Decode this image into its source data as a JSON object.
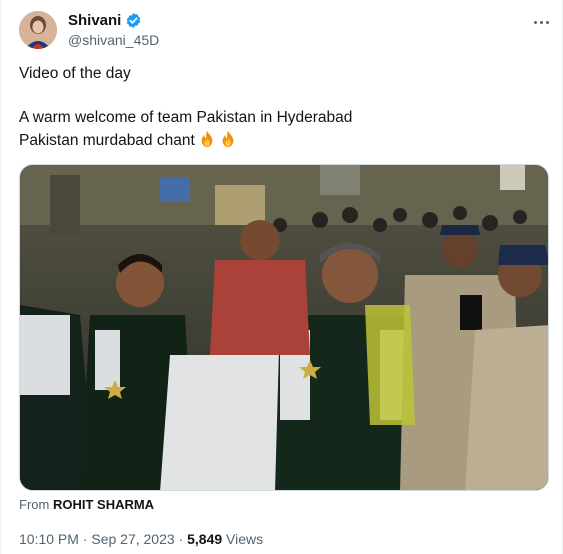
{
  "tweet": {
    "display_name": "Shivani",
    "handle": "@shivani_45D",
    "more_icon": "ellipsis-icon",
    "line1": "Video of the day",
    "line2": "A warm welcome of team Pakistan in Hyderabad",
    "line3": "Pakistan murdabad chant",
    "emoji": "fire-emoji",
    "source_prefix": "From",
    "source_name": "ROHIT SHARMA",
    "timestamp": "10:10 PM · Sep 27, 2023 · ",
    "views_count": "5,849",
    "views_label": " Views"
  },
  "colors": {
    "verified_blue": "#1d9bf0",
    "secondary_text": "#536471",
    "primary_text": "#0f1419"
  }
}
